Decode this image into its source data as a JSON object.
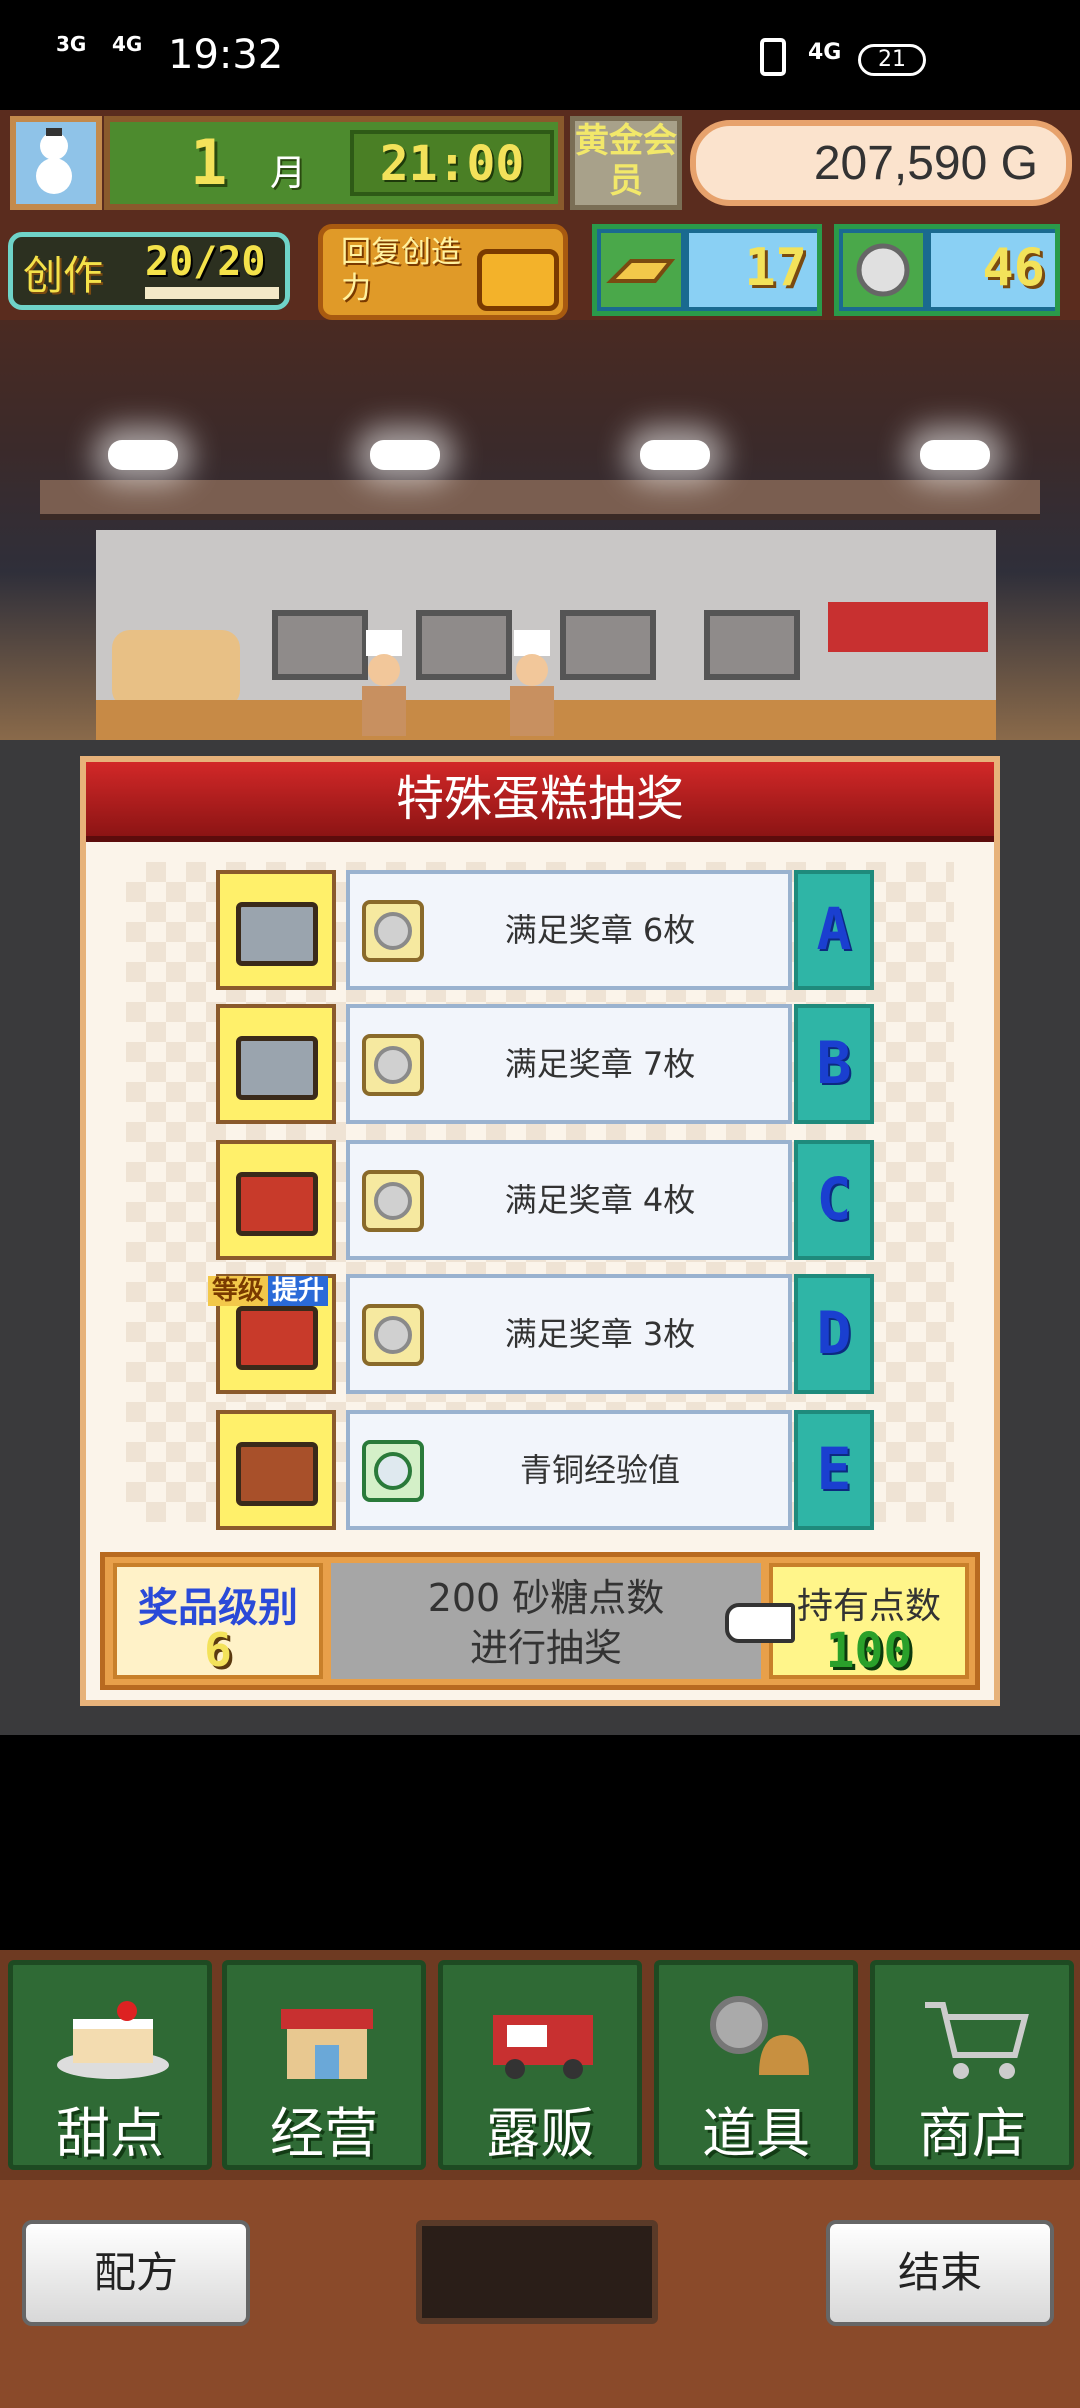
{
  "status_bar": {
    "signal1": "3G",
    "signal2": "4G",
    "time": "19:32",
    "network": "4G",
    "battery": "21"
  },
  "header": {
    "month_num": "1",
    "month_label": "月",
    "clock": "21:00",
    "gold_member": "黄金会员",
    "money": "207,590 G",
    "create_label": "创作",
    "create_count": "20/20",
    "restore_label": "回复创造力",
    "res1_value": "17",
    "res2_value": "46"
  },
  "panel": {
    "title": "特殊蛋糕抽奖",
    "rows": [
      {
        "prize": "满足奖章 6枚",
        "grade": "A",
        "chest": "silver"
      },
      {
        "prize": "满足奖章 7枚",
        "grade": "B",
        "chest": "silver"
      },
      {
        "prize": "满足奖章 4枚",
        "grade": "C",
        "chest": "red"
      },
      {
        "prize": "满足奖章 3枚",
        "grade": "D",
        "chest": "red"
      },
      {
        "prize": "青铜经验值",
        "grade": "E",
        "chest": "dark"
      }
    ],
    "upgrade_tag1": "等级",
    "upgrade_tag2": "提升",
    "level_label": "奖品级别",
    "level_value": "6",
    "draw_line1": "200 砂糖点数",
    "draw_line2": "进行抽奖",
    "hold_label": "持有点数",
    "hold_value": "100"
  },
  "nav": {
    "items": [
      {
        "label": "甜点",
        "icon": "cake-icon"
      },
      {
        "label": "经营",
        "icon": "shop-icon"
      },
      {
        "label": "露贩",
        "icon": "food-truck-icon"
      },
      {
        "label": "道具",
        "icon": "items-icon"
      },
      {
        "label": "商店",
        "icon": "cart-icon"
      }
    ]
  },
  "footer": {
    "recipe_label": "配方",
    "end_label": "结束"
  },
  "colors": {
    "title_red": "#c82020",
    "grade_teal": "#2fb5a6",
    "nav_green": "#2f6a35"
  }
}
